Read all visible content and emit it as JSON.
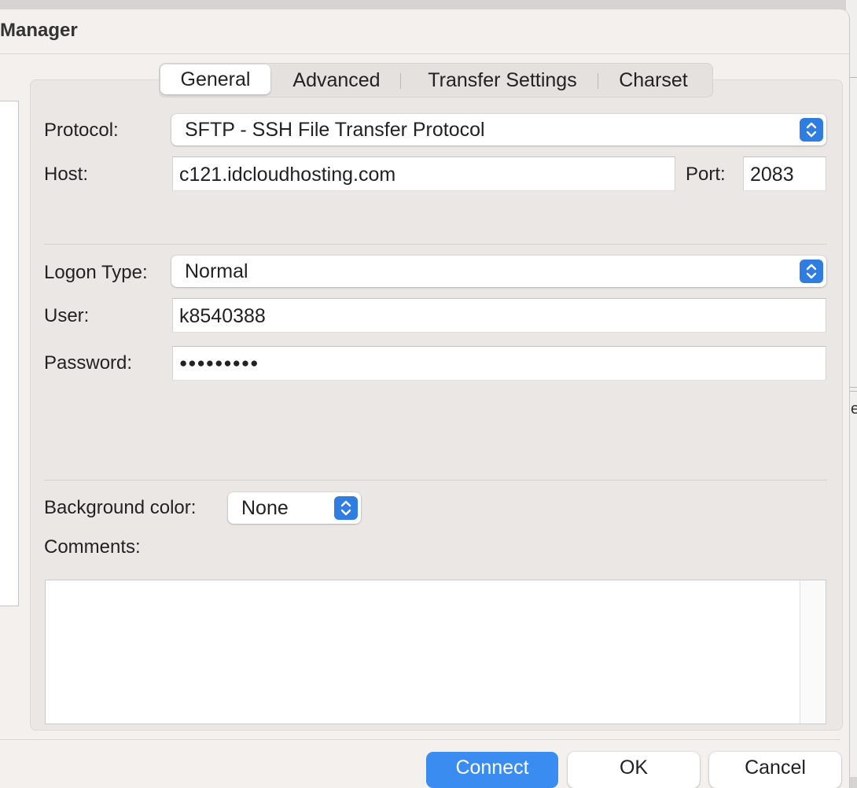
{
  "dialog": {
    "title": "Manager"
  },
  "tabs": [
    {
      "label": "General",
      "active": true
    },
    {
      "label": "Advanced",
      "active": false
    },
    {
      "label": "Transfer Settings",
      "active": false
    },
    {
      "label": "Charset",
      "active": false
    }
  ],
  "general": {
    "protocol_label": "Protocol:",
    "protocol_value": "SFTP - SSH File Transfer Protocol",
    "host_label": "Host:",
    "host_value": "c121.idcloudhosting.com",
    "port_label": "Port:",
    "port_value": "2083",
    "logon_type_label": "Logon Type:",
    "logon_type_value": "Normal",
    "user_label": "User:",
    "user_value": "k8540388",
    "password_label": "Password:",
    "password_masked": "●●●●●●●●●",
    "bg_color_label": "Background color:",
    "bg_color_value": "None",
    "comments_label": "Comments:",
    "comments_value": ""
  },
  "buttons": {
    "connect": "Connect",
    "ok": "OK",
    "cancel": "Cancel"
  },
  "background_window": {
    "visible_letter": "e"
  },
  "colors": {
    "accent": "#3a8cf0",
    "stepper": "#2f7de0",
    "panel": "#ebe7e4",
    "window": "#f3f0ed"
  },
  "icons": {
    "select_stepper": "chevron-up-down-icon"
  }
}
